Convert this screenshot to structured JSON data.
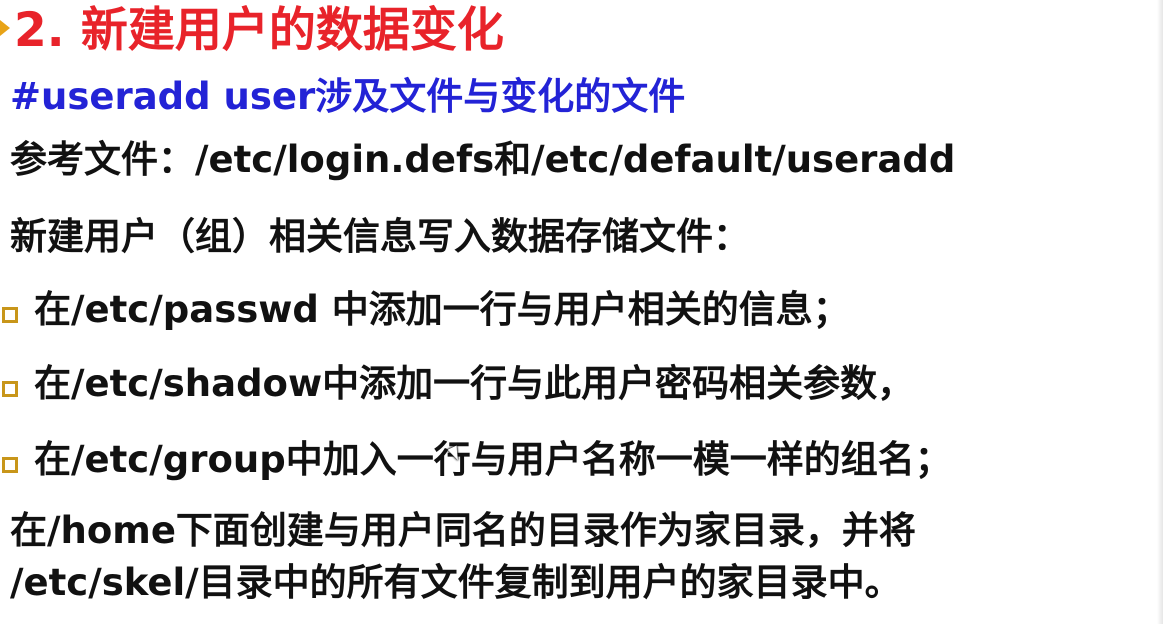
{
  "slide": {
    "title": "2. 新建用户的数据变化",
    "subtitle": "#useradd  user涉及文件与变化的文件",
    "reference_line": "参考文件：/etc/login.defs和/etc/default/useradd",
    "info_line": "新建用户（组）相关信息写入数据存储文件：",
    "bullets": [
      "在/etc/passwd 中添加一行与用户相关的信息；",
      "在/etc/shadow中添加一行与此用户密码相关参数，",
      "在/etc/group中加入一行与用户名称一模一样的组名；"
    ],
    "paragraph_line1": "在/home下面创建与用户同名的目录作为家目录，并将",
    "paragraph_line2": "/etc/skel/目录中的所有文件复制到用户的家目录中。"
  },
  "colors": {
    "title": "#e8232a",
    "subtitle": "#2323d6",
    "body_text": "#111111",
    "bullet_square": "#c8961a",
    "title_marker": "#e8a317"
  }
}
